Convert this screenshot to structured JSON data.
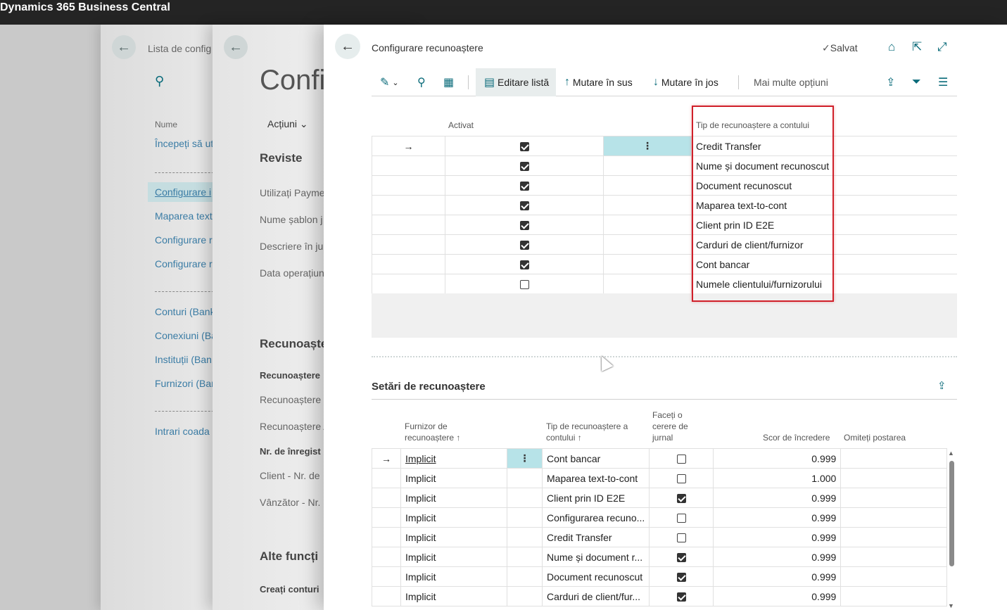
{
  "app": {
    "title": "Dynamics 365 Business Central"
  },
  "bg1": {
    "breadcrumb": "Lista de config",
    "column_header": "Nume",
    "items": [
      "Începeți să ut",
      "Configurare i",
      "Maparea text",
      "Configurare r",
      "Configurare r",
      "Conturi (Bank",
      "Conexiuni (Ba",
      "Instituții (Ban",
      "Furnizori (Bar",
      "Intrari coada"
    ]
  },
  "bg2": {
    "title": "Confi",
    "actions": "Acțiuni",
    "section1": "Reviste",
    "fields1": [
      "Utilizați Payme",
      "Nume șablon j",
      "Descriere în jur",
      "Data operațiun"
    ],
    "section2": "Recunoaște",
    "sub": "Recunoaștere",
    "fields2": [
      "Recunoaștere f",
      "Recunoaștere A"
    ],
    "sub2": "Nr. de înregist",
    "fields3": [
      "Client - Nr. de",
      "Vânzător - Nr."
    ],
    "section3": "Alte funcți",
    "sub3": "Creați conturi"
  },
  "main": {
    "title": "Configurare recunoaștere",
    "saved": "Salvat",
    "toolbar": {
      "edit_list": "Editare listă",
      "move_up": "Mutare în sus",
      "move_down": "Mutare în jos",
      "more": "Mai multe opțiuni"
    },
    "top_grid": {
      "col_enabled": "Activat",
      "col_type": "Tip de recunoaștere a contului",
      "rows": [
        {
          "enabled": true,
          "type": "Credit Transfer"
        },
        {
          "enabled": true,
          "type": "Nume și document recunoscut"
        },
        {
          "enabled": true,
          "type": "Document recunoscut"
        },
        {
          "enabled": true,
          "type": "Maparea text-to-cont"
        },
        {
          "enabled": true,
          "type": "Client prin ID E2E"
        },
        {
          "enabled": true,
          "type": "Carduri de client/furnizor"
        },
        {
          "enabled": true,
          "type": "Cont bancar"
        },
        {
          "enabled": false,
          "type": "Numele clientului/furnizorului"
        }
      ]
    },
    "settings": {
      "title": "Setări de recunoaștere",
      "col_provider": "Furnizor de recunoaștere ↑",
      "col_type": "Tip de recunoaștere a contului ↑",
      "col_journal": "Faceți o cerere de jurnal",
      "col_score": "Scor de încredere",
      "col_skip": "Omiteți postarea",
      "rows": [
        {
          "provider": "Implicit",
          "type": "Cont bancar",
          "journal": false,
          "score": "0.999"
        },
        {
          "provider": "Implicit",
          "type": "Maparea text-to-cont",
          "journal": false,
          "score": "1.000"
        },
        {
          "provider": "Implicit",
          "type": "Client prin ID E2E",
          "journal": true,
          "score": "0.999"
        },
        {
          "provider": "Implicit",
          "type": "Configurarea recuno...",
          "journal": false,
          "score": "0.999"
        },
        {
          "provider": "Implicit",
          "type": "Credit Transfer",
          "journal": false,
          "score": "0.999"
        },
        {
          "provider": "Implicit",
          "type": "Nume și document r...",
          "journal": true,
          "score": "0.999"
        },
        {
          "provider": "Implicit",
          "type": "Document recunoscut",
          "journal": true,
          "score": "0.999"
        },
        {
          "provider": "Implicit",
          "type": "Carduri de client/fur...",
          "journal": true,
          "score": "0.999"
        }
      ]
    }
  },
  "colors": {
    "accent": "#0a6b7a",
    "highlight": "#d0202a",
    "topbar": "#242424"
  }
}
